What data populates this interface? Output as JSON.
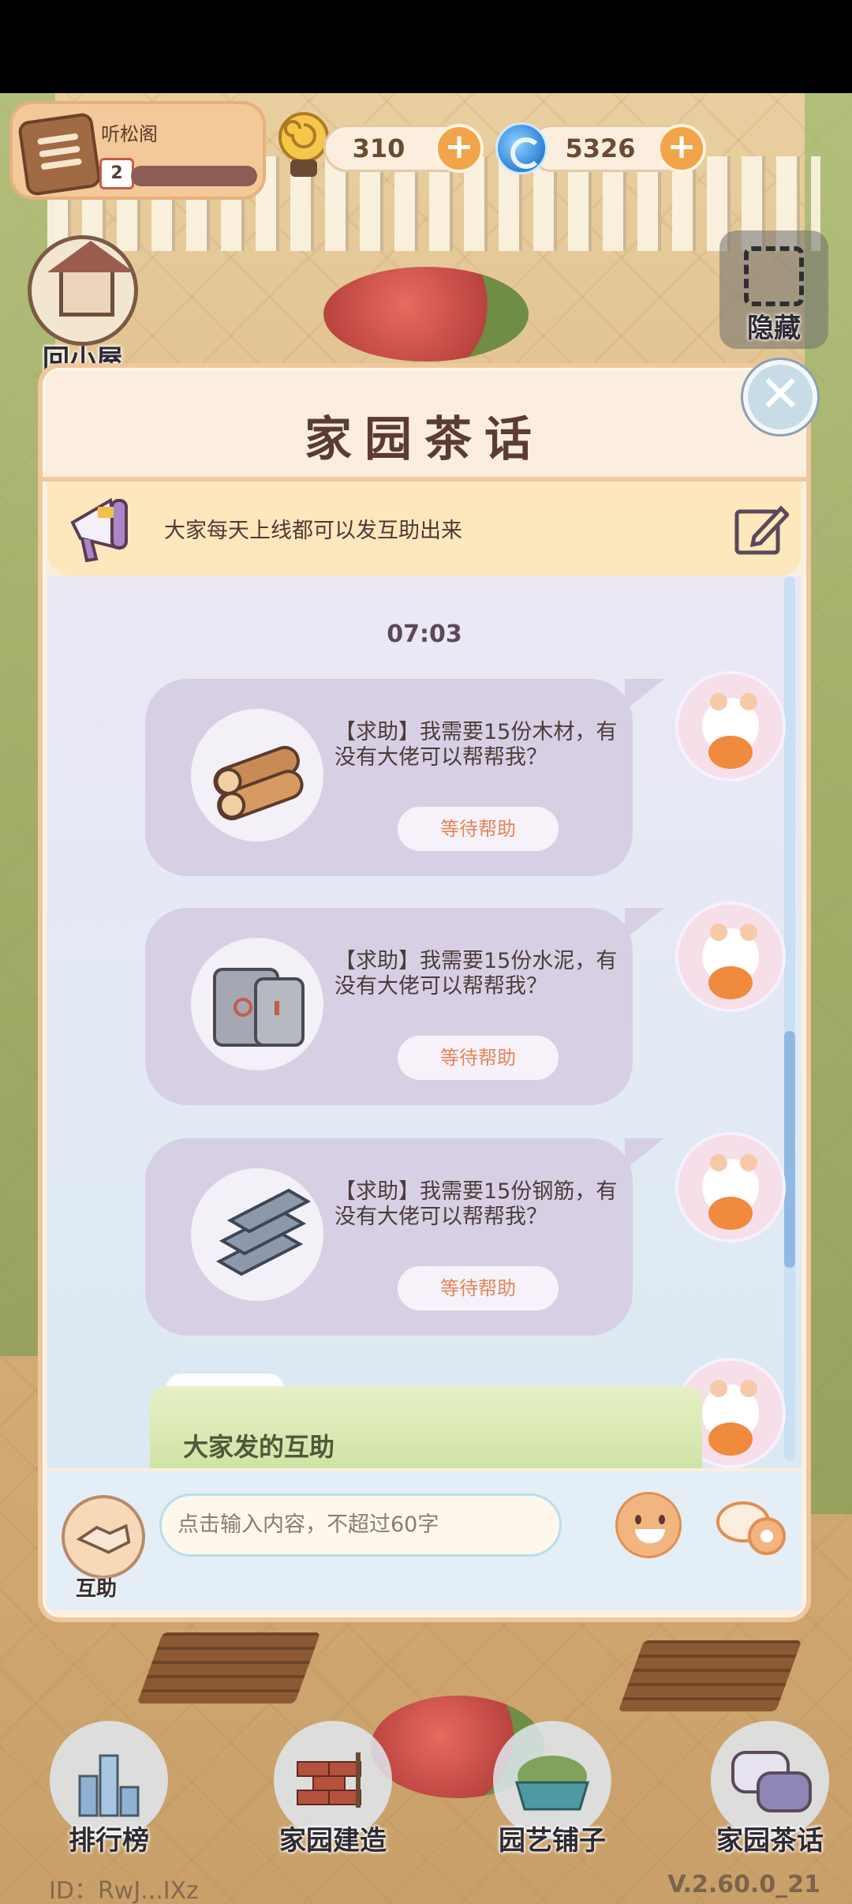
{
  "hud": {
    "player_name": "听松阁",
    "level": "2",
    "coins": "310",
    "gems": "5326",
    "plus_symbol": "+"
  },
  "side_buttons": {
    "home": "回小屋",
    "hide": "隐藏"
  },
  "panel": {
    "title": "家园茶话",
    "notice": "大家每天上线都可以发互助出来",
    "timestamp": "07:03",
    "messages": [
      {
        "item": "wood-logs-icon",
        "text": "【求助】我需要15份木材，有没有大佬可以帮帮我？",
        "button": "等待帮助"
      },
      {
        "item": "cement-bags-icon",
        "text": "【求助】我需要15份水泥，有没有大佬可以帮帮我？",
        "button": "等待帮助"
      },
      {
        "item": "steel-bars-icon",
        "text": "【求助】我需要15份钢筋，有没有大佬可以帮帮我？",
        "button": "等待帮助"
      }
    ],
    "banner": "大家发的互助",
    "help_label": "互助",
    "input_placeholder": "点击输入内容，不超过60字",
    "close_symbol": "✕"
  },
  "bottom_nav": [
    {
      "label": "排行榜",
      "icon": "leaderboard-icon"
    },
    {
      "label": "家园建造",
      "icon": "build-icon"
    },
    {
      "label": "园艺铺子",
      "icon": "garden-shop-icon"
    },
    {
      "label": "家园茶话",
      "icon": "chat-icon"
    }
  ],
  "footer": {
    "id": "ID：RwJ...IXz",
    "version": "V.2.60.0_21"
  },
  "colors": {
    "panel_bg": "#fbeede",
    "bubble": "#d7d0e4",
    "accent_orange": "#f2a44a",
    "title_text": "#5b3b33"
  }
}
